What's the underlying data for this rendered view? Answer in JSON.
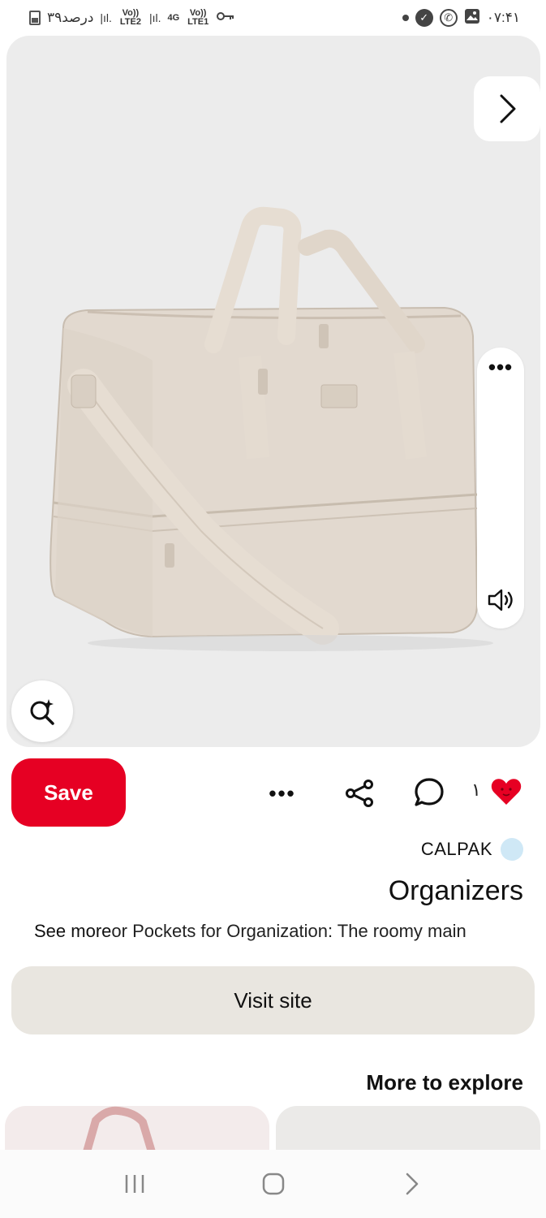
{
  "status_bar": {
    "battery_text": "۳۹درصد",
    "sim2_label": "Vo)) LTE2",
    "sim1_label": "Vo)) LTE1",
    "network_label": "4G",
    "time": "۰۷:۴۱",
    "icons": [
      "battery-icon",
      "signal-icon",
      "key-icon",
      "dot-icon",
      "shield-icon",
      "whatsapp-icon",
      "gallery-icon"
    ]
  },
  "pin": {
    "image_description_icon": "duffel-bag-image",
    "like_count": "۱",
    "save_label": "Save",
    "creator": "CALPAK",
    "title": "Organizers",
    "see_more_label": "See more",
    "description": "or Pockets for Organization: The roomy main",
    "visit_label": "Visit site"
  },
  "explore": {
    "heading": "More to explore"
  },
  "colors": {
    "save_red": "#e60023",
    "heart_red": "#e60023",
    "visit_bg": "#e9e6e0",
    "verified_blue": "#cfe8f6"
  }
}
